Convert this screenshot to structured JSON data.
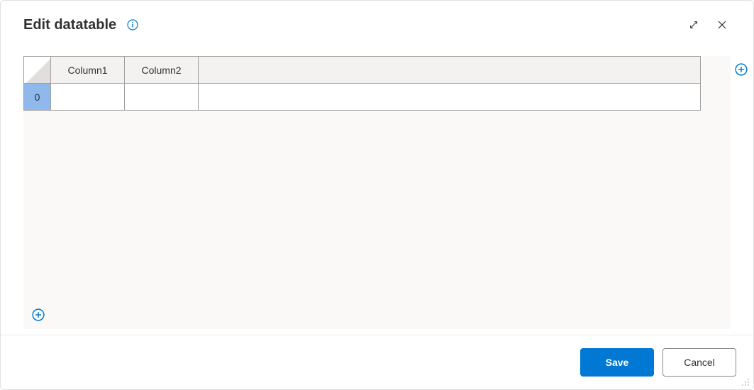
{
  "dialog": {
    "title": "Edit datatable"
  },
  "grid": {
    "columns": [
      "Column1",
      "Column2",
      ""
    ],
    "rows": [
      {
        "index": "0",
        "cells": [
          "",
          "",
          ""
        ]
      }
    ]
  },
  "footer": {
    "save_label": "Save",
    "cancel_label": "Cancel"
  }
}
